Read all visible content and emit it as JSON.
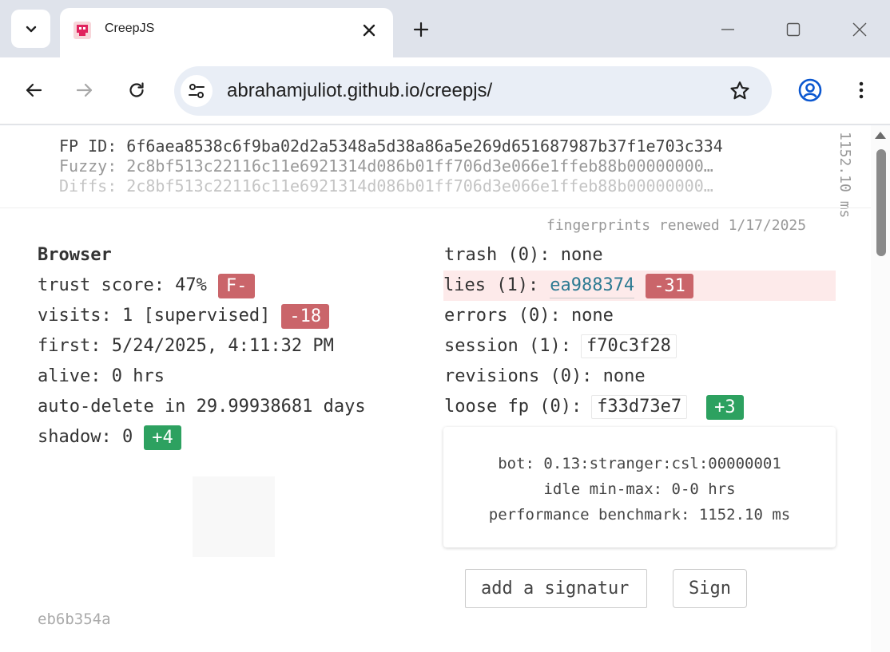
{
  "browser": {
    "tab_title": "CreepJS",
    "url": "abrahamjuliot.github.io/creepjs/"
  },
  "fingerprint": {
    "id_label": "FP ID:",
    "id_value": "6f6aea8538c6f9ba02d2a5348a5d38a86a5e269d651687987b37f1e703c334",
    "fuzzy_label": "Fuzzy:",
    "fuzzy_value": "2c8bf513c22116c11e6921314d086b01ff706d3e066e1ffeb88b00000000…",
    "diffs_label": "Diffs:",
    "diffs_value": "2c8bf513c22116c11e6921314d086b01ff706d3e066e1ffeb88b00000000…",
    "timing": "1152.10 ms",
    "renewed": "fingerprints renewed 1/17/2025"
  },
  "left": {
    "title": "Browser",
    "trust_score": "trust score: 47%",
    "trust_grade": "F-",
    "visits": "visits: 1 [supervised]",
    "visits_badge": "-18",
    "first": "first: 5/24/2025, 4:11:32 PM",
    "alive": "alive: 0 hrs",
    "auto_delete": "auto-delete in 29.99938681 days",
    "shadow": "shadow: 0",
    "shadow_badge": "+4"
  },
  "right": {
    "trash": "trash (0): none",
    "lies_label": "lies (1):",
    "lies_hash": "ea988374",
    "lies_badge": "-31",
    "errors": "errors (0): none",
    "session_label": "session (1):",
    "session_hash": "f70c3f28",
    "revisions": "revisions (0): none",
    "loose_label": "loose fp (0):",
    "loose_hash": "f33d73e7",
    "loose_badge": "+3"
  },
  "bot_card": {
    "bot": "bot: 0.13:stranger:csl:00000001",
    "idle": "idle min-max: 0-0 hrs",
    "benchmark": "performance benchmark: 1152.10 ms"
  },
  "signature": {
    "input_value": "add a signatur",
    "sign_label": "Sign"
  },
  "footer_hash": "eb6b354a",
  "colors": {
    "badge_red": "#ca656a",
    "badge_green": "#2da160",
    "lies_highlight": "#fdeaea",
    "link": "#2d7a92"
  }
}
